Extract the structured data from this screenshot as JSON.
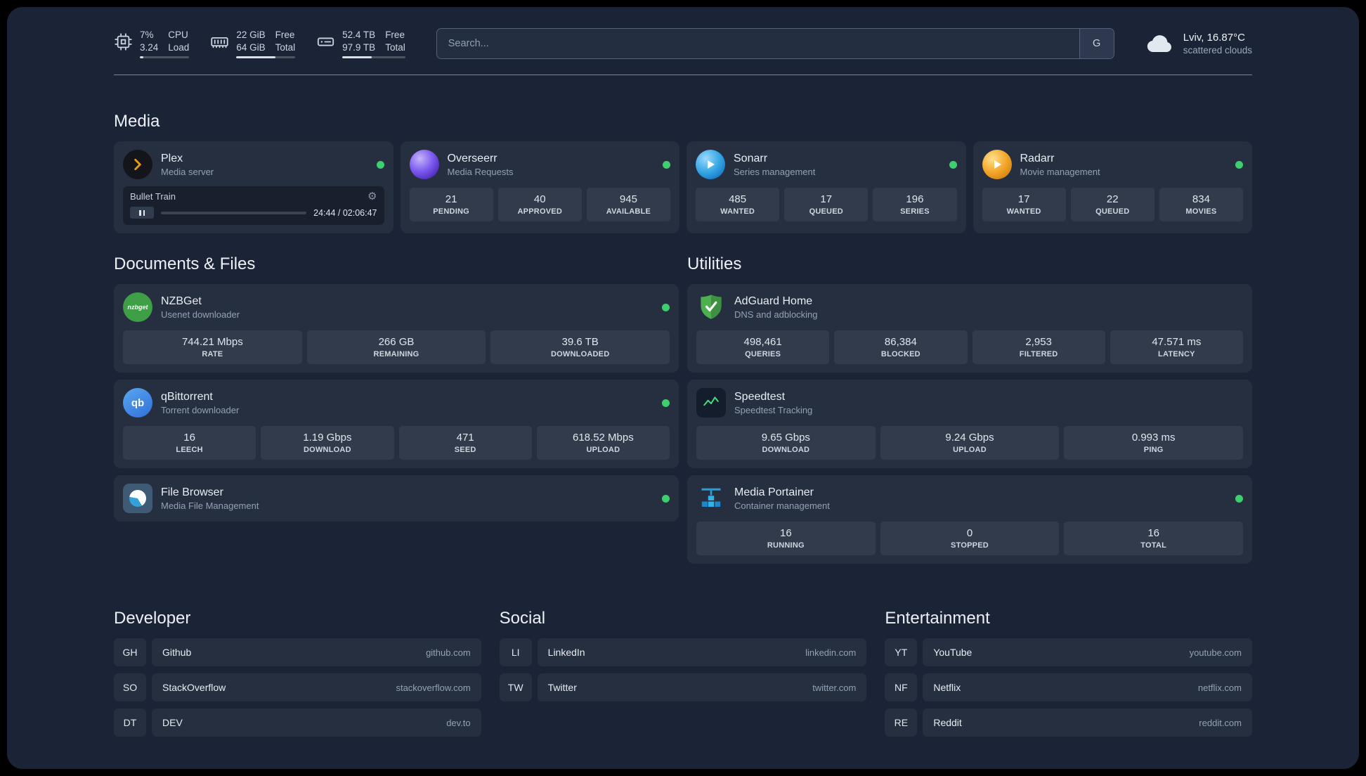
{
  "colors": {
    "status_green": "#3ecf6f",
    "plex_gold": "#e5a00d",
    "accent_bg": "#1b2436"
  },
  "topbar": {
    "cpu": {
      "value1": "7%",
      "value2": "3.24",
      "label1": "CPU",
      "label2": "Load",
      "bar_style": "width:7%"
    },
    "memory": {
      "value1": "22 GiB",
      "value2": "64 GiB",
      "label1": "Free",
      "label2": "Total",
      "bar_style": "width:66%"
    },
    "disk": {
      "value1": "52.4 TB",
      "value2": "97.9 TB",
      "label1": "Free",
      "label2": "Total",
      "bar_style": "width:47%"
    },
    "search": {
      "placeholder": "Search...",
      "provider_label": "G"
    },
    "weather": {
      "location": "Lviv, 16.87°C",
      "condition": "scattered clouds"
    }
  },
  "media": {
    "heading": "Media",
    "plex": {
      "name": "Plex",
      "subtitle": "Media server",
      "now_playing": "Bullet Train",
      "time": "24:44 / 02:06:47",
      "progress_style": "width:19%"
    },
    "overseerr": {
      "name": "Overseerr",
      "subtitle": "Media Requests",
      "stats": [
        {
          "value": "21",
          "label": "PENDING"
        },
        {
          "value": "40",
          "label": "APPROVED"
        },
        {
          "value": "945",
          "label": "AVAILABLE"
        }
      ]
    },
    "sonarr": {
      "name": "Sonarr",
      "subtitle": "Series management",
      "stats": [
        {
          "value": "485",
          "label": "WANTED"
        },
        {
          "value": "17",
          "label": "QUEUED"
        },
        {
          "value": "196",
          "label": "SERIES"
        }
      ]
    },
    "radarr": {
      "name": "Radarr",
      "subtitle": "Movie management",
      "stats": [
        {
          "value": "17",
          "label": "WANTED"
        },
        {
          "value": "22",
          "label": "QUEUED"
        },
        {
          "value": "834",
          "label": "MOVIES"
        }
      ]
    }
  },
  "documents": {
    "heading": "Documents & Files",
    "nzbget": {
      "name": "NZBGet",
      "subtitle": "Usenet downloader",
      "icon_label": "nzbget",
      "stats": [
        {
          "value": "744.21 Mbps",
          "label": "RATE"
        },
        {
          "value": "266 GB",
          "label": "REMAINING"
        },
        {
          "value": "39.6 TB",
          "label": "DOWNLOADED"
        }
      ]
    },
    "qbittorrent": {
      "name": "qBittorrent",
      "subtitle": "Torrent downloader",
      "icon_label": "qb",
      "stats": [
        {
          "value": "16",
          "label": "LEECH"
        },
        {
          "value": "1.19 Gbps",
          "label": "DOWNLOAD"
        },
        {
          "value": "471",
          "label": "SEED"
        },
        {
          "value": "618.52 Mbps",
          "label": "UPLOAD"
        }
      ]
    },
    "filebrowser": {
      "name": "File Browser",
      "subtitle": "Media File Management"
    }
  },
  "utilities": {
    "heading": "Utilities",
    "adguard": {
      "name": "AdGuard Home",
      "subtitle": "DNS and adblocking",
      "stats": [
        {
          "value": "498,461",
          "label": "QUERIES"
        },
        {
          "value": "86,384",
          "label": "BLOCKED"
        },
        {
          "value": "2,953",
          "label": "FILTERED"
        },
        {
          "value": "47.571 ms",
          "label": "LATENCY"
        }
      ]
    },
    "speedtest": {
      "name": "Speedtest",
      "subtitle": "Speedtest Tracking",
      "stats": [
        {
          "value": "9.65 Gbps",
          "label": "DOWNLOAD"
        },
        {
          "value": "9.24 Gbps",
          "label": "UPLOAD"
        },
        {
          "value": "0.993 ms",
          "label": "PING"
        }
      ]
    },
    "portainer": {
      "name": "Media Portainer",
      "subtitle": "Container management",
      "stats": [
        {
          "value": "16",
          "label": "RUNNING"
        },
        {
          "value": "0",
          "label": "STOPPED"
        },
        {
          "value": "16",
          "label": "TOTAL"
        }
      ]
    }
  },
  "bookmarks": {
    "developer": {
      "heading": "Developer",
      "items": [
        {
          "abbr": "GH",
          "name": "Github",
          "domain": "github.com"
        },
        {
          "abbr": "SO",
          "name": "StackOverflow",
          "domain": "stackoverflow.com"
        },
        {
          "abbr": "DT",
          "name": "DEV",
          "domain": "dev.to"
        }
      ]
    },
    "social": {
      "heading": "Social",
      "items": [
        {
          "abbr": "LI",
          "name": "LinkedIn",
          "domain": "linkedin.com"
        },
        {
          "abbr": "TW",
          "name": "Twitter",
          "domain": "twitter.com"
        }
      ]
    },
    "entertainment": {
      "heading": "Entertainment",
      "items": [
        {
          "abbr": "YT",
          "name": "YouTube",
          "domain": "youtube.com"
        },
        {
          "abbr": "NF",
          "name": "Netflix",
          "domain": "netflix.com"
        },
        {
          "abbr": "RE",
          "name": "Reddit",
          "domain": "reddit.com"
        }
      ]
    }
  }
}
